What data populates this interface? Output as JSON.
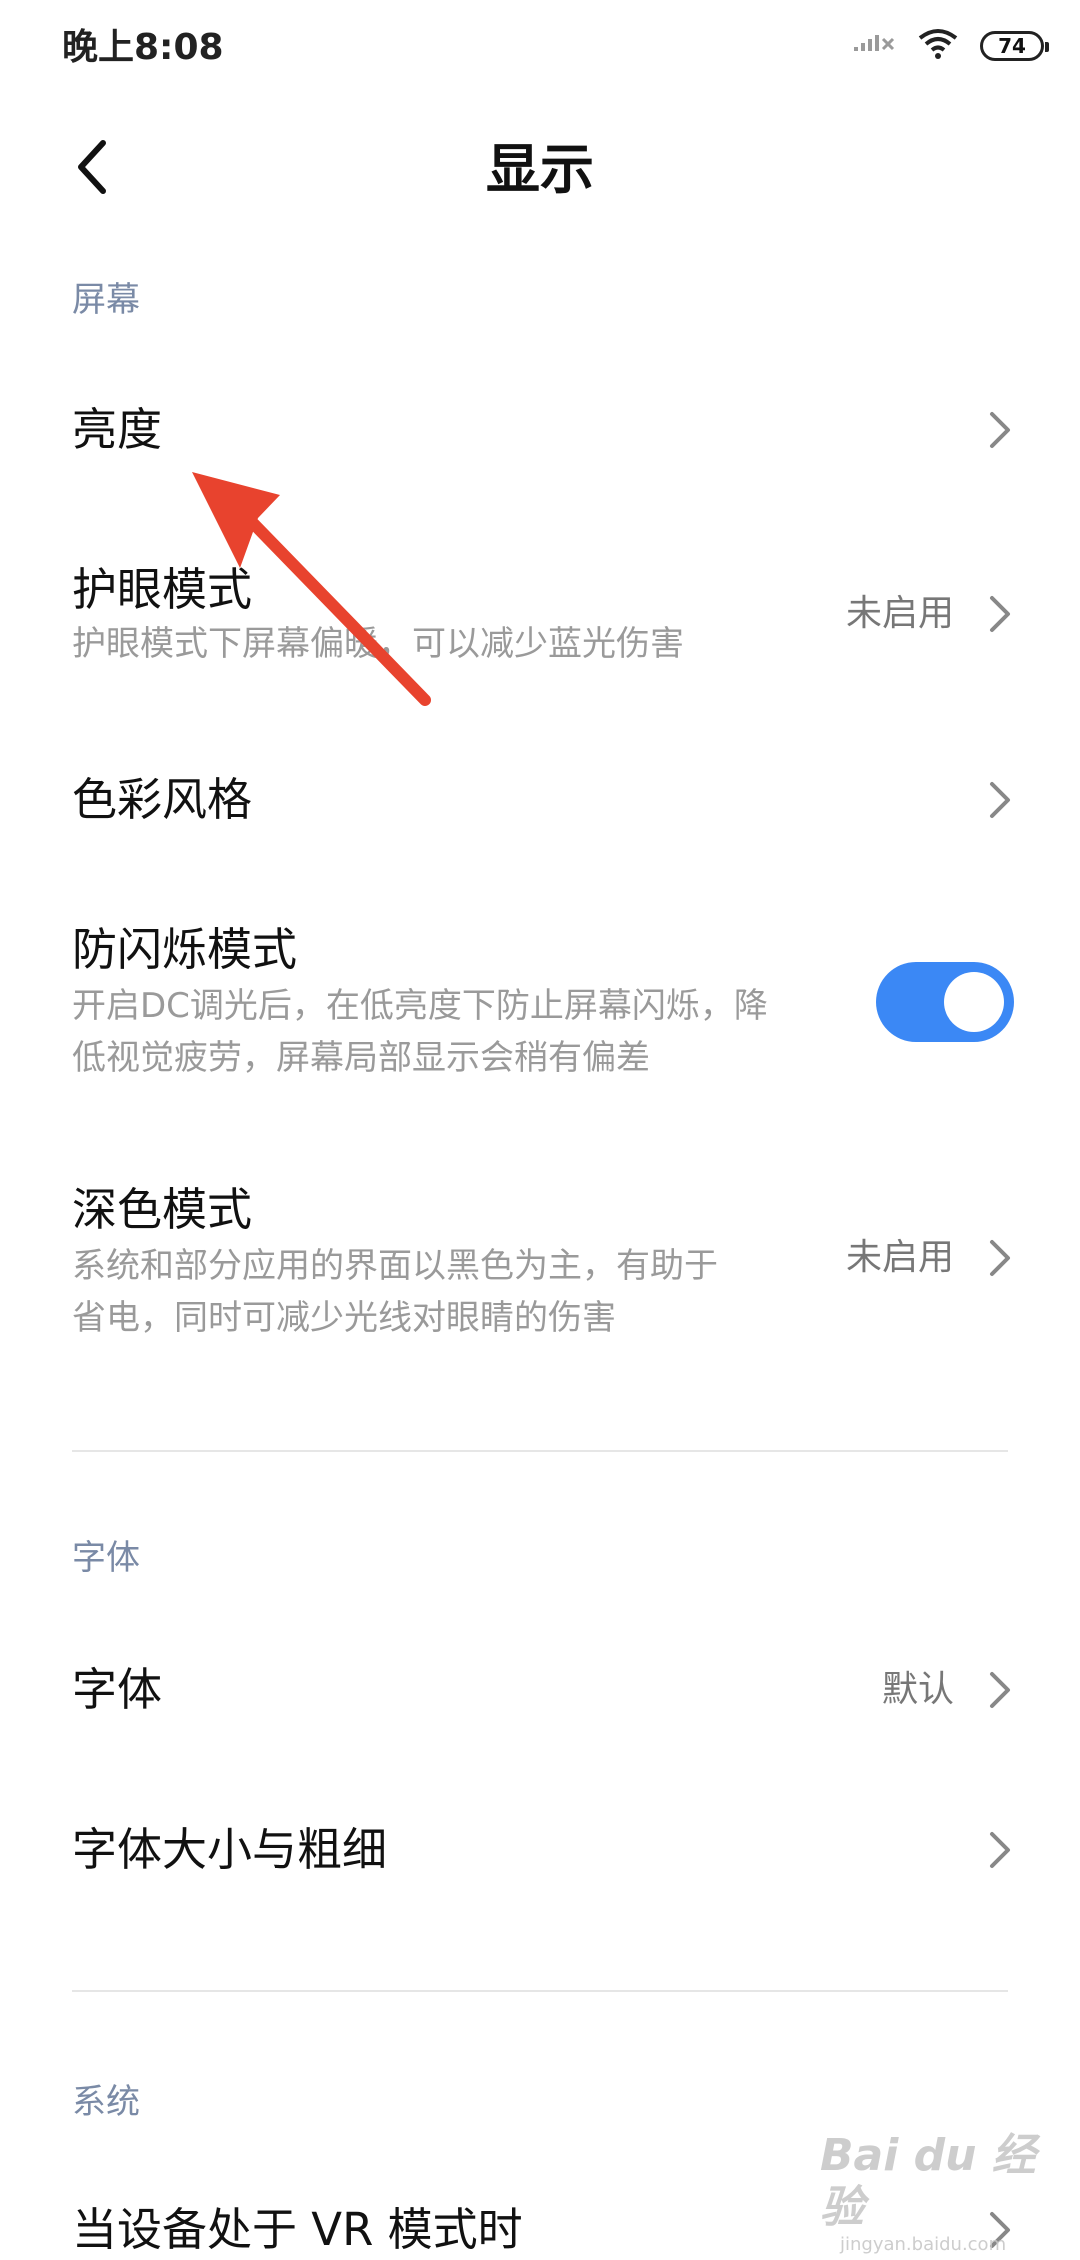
{
  "status_bar": {
    "time": "晚上8:08",
    "battery": "74",
    "icons": [
      "signal-off-icon",
      "wifi-icon",
      "battery-icon"
    ]
  },
  "nav": {
    "title": "显示",
    "back_icon": "chevron-left-icon"
  },
  "sections": {
    "screen": {
      "header": "屏幕",
      "brightness": {
        "title": "亮度"
      },
      "eye_care": {
        "title": "护眼模式",
        "subtitle": "护眼模式下屏幕偏暖，可以减少蓝光伤害",
        "value": "未启用"
      },
      "color_style": {
        "title": "色彩风格"
      },
      "anti_flicker": {
        "title": "防闪烁模式",
        "subtitle_line1": "开启DC调光后，在低亮度下防止屏幕闪烁，降",
        "subtitle_line2": "低视觉疲劳，屏幕局部显示会稍有偏差",
        "enabled": true
      },
      "dark_mode": {
        "title": "深色模式",
        "subtitle_line1": "系统和部分应用的界面以黑色为主，有助于",
        "subtitle_line2": "省电，同时可减少光线对眼睛的伤害",
        "value": "未启用"
      }
    },
    "font": {
      "header": "字体",
      "font": {
        "title": "字体",
        "value": "默认"
      },
      "font_size": {
        "title": "字体大小与粗细"
      }
    },
    "system": {
      "header": "系统",
      "vr": {
        "title": "当设备处于 VR 模式时"
      }
    }
  },
  "colors": {
    "accent": "#3b88f5",
    "annotation_arrow": "#e8432e",
    "section_header": "#7a8aa6"
  },
  "watermark": {
    "main": "Bai du 经验",
    "sub": "jingyan.baidu.com"
  }
}
